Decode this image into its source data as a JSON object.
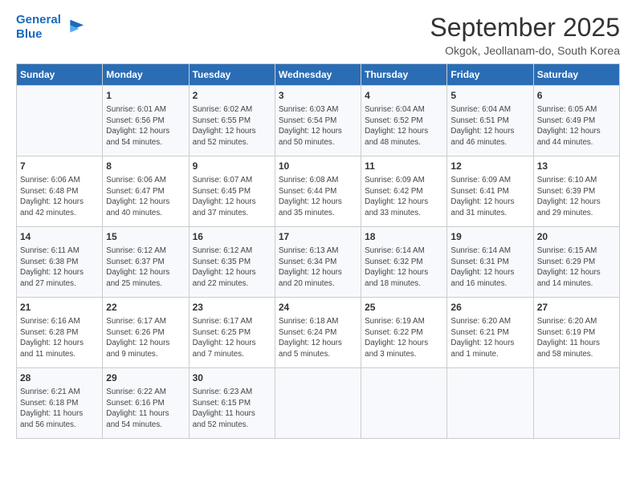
{
  "header": {
    "logo_line1": "General",
    "logo_line2": "Blue",
    "month": "September 2025",
    "location": "Okgok, Jeollanam-do, South Korea"
  },
  "days_of_week": [
    "Sunday",
    "Monday",
    "Tuesday",
    "Wednesday",
    "Thursday",
    "Friday",
    "Saturday"
  ],
  "weeks": [
    [
      {
        "day": "",
        "info": ""
      },
      {
        "day": "1",
        "info": "Sunrise: 6:01 AM\nSunset: 6:56 PM\nDaylight: 12 hours\nand 54 minutes."
      },
      {
        "day": "2",
        "info": "Sunrise: 6:02 AM\nSunset: 6:55 PM\nDaylight: 12 hours\nand 52 minutes."
      },
      {
        "day": "3",
        "info": "Sunrise: 6:03 AM\nSunset: 6:54 PM\nDaylight: 12 hours\nand 50 minutes."
      },
      {
        "day": "4",
        "info": "Sunrise: 6:04 AM\nSunset: 6:52 PM\nDaylight: 12 hours\nand 48 minutes."
      },
      {
        "day": "5",
        "info": "Sunrise: 6:04 AM\nSunset: 6:51 PM\nDaylight: 12 hours\nand 46 minutes."
      },
      {
        "day": "6",
        "info": "Sunrise: 6:05 AM\nSunset: 6:49 PM\nDaylight: 12 hours\nand 44 minutes."
      }
    ],
    [
      {
        "day": "7",
        "info": "Sunrise: 6:06 AM\nSunset: 6:48 PM\nDaylight: 12 hours\nand 42 minutes."
      },
      {
        "day": "8",
        "info": "Sunrise: 6:06 AM\nSunset: 6:47 PM\nDaylight: 12 hours\nand 40 minutes."
      },
      {
        "day": "9",
        "info": "Sunrise: 6:07 AM\nSunset: 6:45 PM\nDaylight: 12 hours\nand 37 minutes."
      },
      {
        "day": "10",
        "info": "Sunrise: 6:08 AM\nSunset: 6:44 PM\nDaylight: 12 hours\nand 35 minutes."
      },
      {
        "day": "11",
        "info": "Sunrise: 6:09 AM\nSunset: 6:42 PM\nDaylight: 12 hours\nand 33 minutes."
      },
      {
        "day": "12",
        "info": "Sunrise: 6:09 AM\nSunset: 6:41 PM\nDaylight: 12 hours\nand 31 minutes."
      },
      {
        "day": "13",
        "info": "Sunrise: 6:10 AM\nSunset: 6:39 PM\nDaylight: 12 hours\nand 29 minutes."
      }
    ],
    [
      {
        "day": "14",
        "info": "Sunrise: 6:11 AM\nSunset: 6:38 PM\nDaylight: 12 hours\nand 27 minutes."
      },
      {
        "day": "15",
        "info": "Sunrise: 6:12 AM\nSunset: 6:37 PM\nDaylight: 12 hours\nand 25 minutes."
      },
      {
        "day": "16",
        "info": "Sunrise: 6:12 AM\nSunset: 6:35 PM\nDaylight: 12 hours\nand 22 minutes."
      },
      {
        "day": "17",
        "info": "Sunrise: 6:13 AM\nSunset: 6:34 PM\nDaylight: 12 hours\nand 20 minutes."
      },
      {
        "day": "18",
        "info": "Sunrise: 6:14 AM\nSunset: 6:32 PM\nDaylight: 12 hours\nand 18 minutes."
      },
      {
        "day": "19",
        "info": "Sunrise: 6:14 AM\nSunset: 6:31 PM\nDaylight: 12 hours\nand 16 minutes."
      },
      {
        "day": "20",
        "info": "Sunrise: 6:15 AM\nSunset: 6:29 PM\nDaylight: 12 hours\nand 14 minutes."
      }
    ],
    [
      {
        "day": "21",
        "info": "Sunrise: 6:16 AM\nSunset: 6:28 PM\nDaylight: 12 hours\nand 11 minutes."
      },
      {
        "day": "22",
        "info": "Sunrise: 6:17 AM\nSunset: 6:26 PM\nDaylight: 12 hours\nand 9 minutes."
      },
      {
        "day": "23",
        "info": "Sunrise: 6:17 AM\nSunset: 6:25 PM\nDaylight: 12 hours\nand 7 minutes."
      },
      {
        "day": "24",
        "info": "Sunrise: 6:18 AM\nSunset: 6:24 PM\nDaylight: 12 hours\nand 5 minutes."
      },
      {
        "day": "25",
        "info": "Sunrise: 6:19 AM\nSunset: 6:22 PM\nDaylight: 12 hours\nand 3 minutes."
      },
      {
        "day": "26",
        "info": "Sunrise: 6:20 AM\nSunset: 6:21 PM\nDaylight: 12 hours\nand 1 minute."
      },
      {
        "day": "27",
        "info": "Sunrise: 6:20 AM\nSunset: 6:19 PM\nDaylight: 11 hours\nand 58 minutes."
      }
    ],
    [
      {
        "day": "28",
        "info": "Sunrise: 6:21 AM\nSunset: 6:18 PM\nDaylight: 11 hours\nand 56 minutes."
      },
      {
        "day": "29",
        "info": "Sunrise: 6:22 AM\nSunset: 6:16 PM\nDaylight: 11 hours\nand 54 minutes."
      },
      {
        "day": "30",
        "info": "Sunrise: 6:23 AM\nSunset: 6:15 PM\nDaylight: 11 hours\nand 52 minutes."
      },
      {
        "day": "",
        "info": ""
      },
      {
        "day": "",
        "info": ""
      },
      {
        "day": "",
        "info": ""
      },
      {
        "day": "",
        "info": ""
      }
    ]
  ]
}
